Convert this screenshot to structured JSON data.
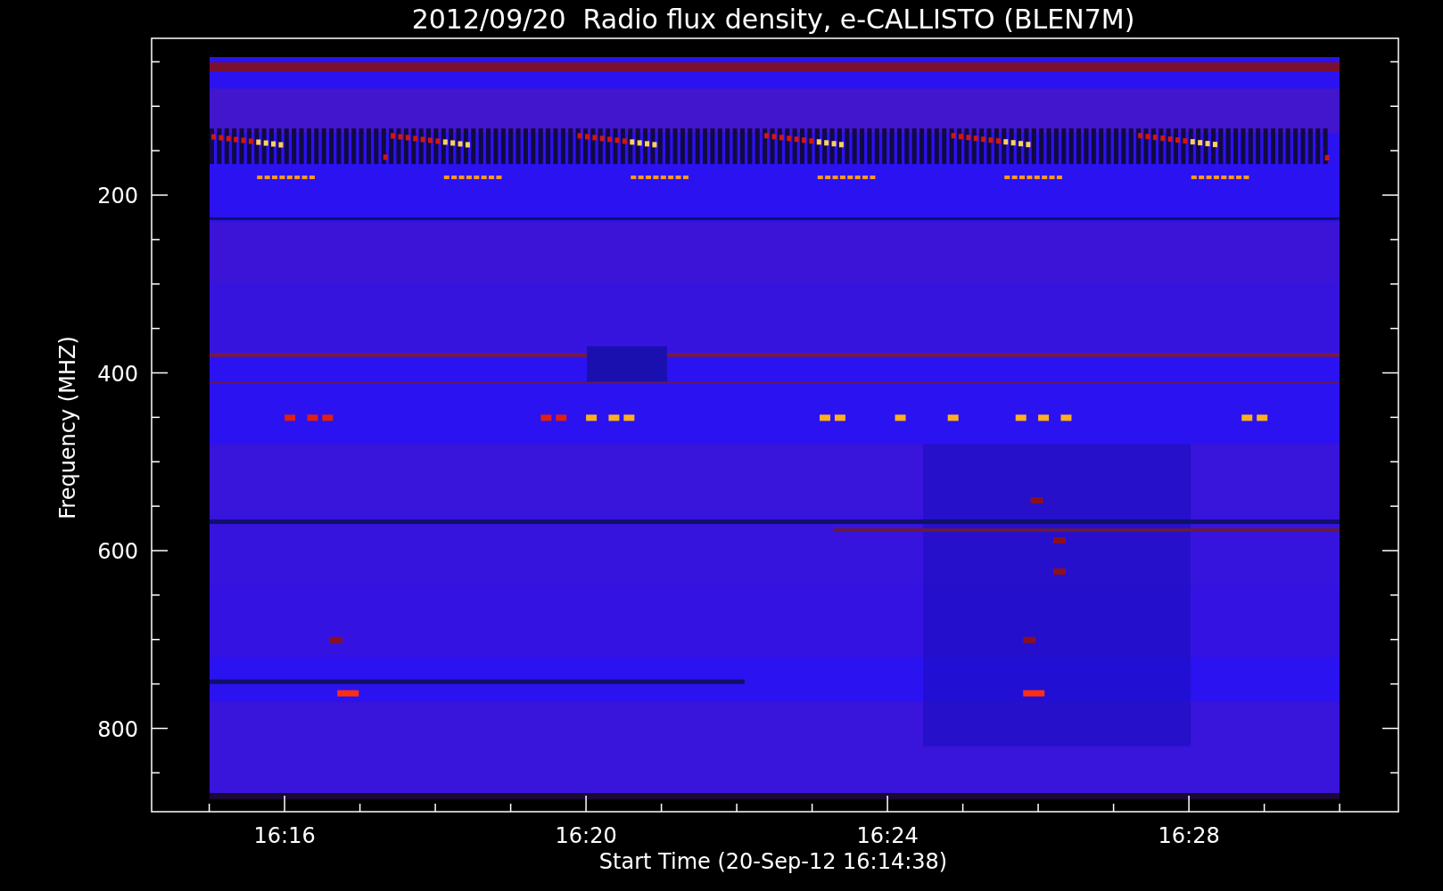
{
  "title": "2012/09/20  Radio flux density, e-CALLISTO (BLEN7M)",
  "y_axis": {
    "label": "Frequency (MHZ)",
    "ticks": [
      "200",
      "400",
      "600",
      "800"
    ]
  },
  "x_axis": {
    "label": "Start Time (20-Sep-12 16:14:38)",
    "ticks": [
      "16:16",
      "16:20",
      "16:24",
      "16:28"
    ]
  }
}
